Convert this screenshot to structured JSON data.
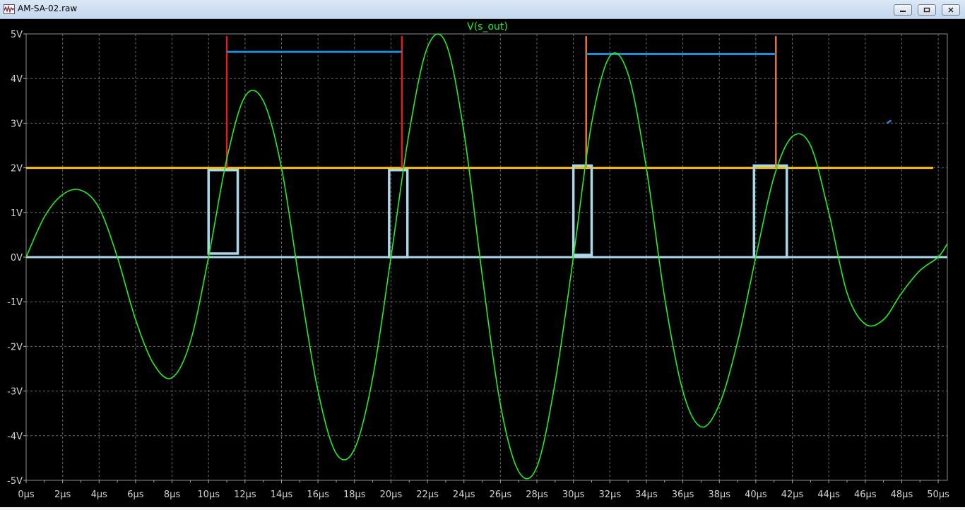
{
  "window": {
    "title": "AM-SA-02.raw"
  },
  "chart_data": {
    "type": "line",
    "title": "V(s_out)",
    "xlabel": "",
    "ylabel": "",
    "xlim": [
      0,
      50.5
    ],
    "ylim": [
      -5,
      5
    ],
    "x_ticks": [
      "0µs",
      "2µs",
      "4µs",
      "6µs",
      "8µs",
      "10µs",
      "12µs",
      "14µs",
      "16µs",
      "18µs",
      "20µs",
      "22µs",
      "24µs",
      "26µs",
      "28µs",
      "30µs",
      "32µs",
      "34µs",
      "36µs",
      "38µs",
      "40µs",
      "42µs",
      "44µs",
      "46µs",
      "48µs",
      "50µs"
    ],
    "y_ticks": [
      "5V",
      "4V",
      "3V",
      "2V",
      "1V",
      "0V",
      "-1V",
      "-2V",
      "-3V",
      "-4V",
      "-5V"
    ],
    "grid": true,
    "series": [
      {
        "name": "V(s_out)",
        "color": "#22ee22",
        "x_us": [
          0,
          1,
          2,
          3,
          4,
          5,
          6,
          7,
          8,
          9,
          10,
          11,
          12,
          13,
          14,
          15,
          16,
          17,
          18,
          19,
          20,
          21,
          22,
          23,
          24,
          25,
          26,
          27,
          28,
          29,
          30,
          31,
          32,
          33,
          34,
          35,
          36,
          37,
          38,
          39,
          40,
          41,
          42,
          43,
          44,
          45,
          46,
          47,
          48,
          49,
          50,
          50.5
        ],
        "y_v": [
          0,
          0.9,
          1.4,
          1.5,
          1.1,
          0,
          -1.4,
          -2.4,
          -2.7,
          -1.9,
          0,
          2.2,
          3.6,
          3.5,
          2.0,
          -0.6,
          -3.0,
          -4.4,
          -4.3,
          -2.7,
          0,
          2.8,
          4.7,
          4.8,
          2.8,
          -0.4,
          -3.3,
          -4.8,
          -4.7,
          -2.8,
          0,
          3.0,
          4.5,
          4.1,
          2.0,
          -0.9,
          -3.0,
          -3.8,
          -3.3,
          -1.9,
          0,
          1.8,
          2.7,
          2.5,
          1.0,
          -0.8,
          -1.5,
          -1.4,
          -0.8,
          -0.3,
          0,
          0.3
        ]
      }
    ],
    "annotations": {
      "threshold_line": {
        "y_v": 2,
        "x_from_us": 0,
        "x_to_us": 50.5,
        "color": "#ffc000"
      },
      "zero_line": {
        "y_v": 0,
        "x_from_us": 0,
        "x_to_us": 50.5,
        "color": "#a8d8ea"
      },
      "pulses": [
        {
          "x0_us": 10.0,
          "x1_us": 11.6,
          "y0_v": 0.08,
          "y1_v": 1.95
        },
        {
          "x0_us": 19.9,
          "x1_us": 20.9,
          "y0_v": 0.0,
          "y1_v": 1.95
        },
        {
          "x0_us": 30.0,
          "x1_us": 31.0,
          "y0_v": 0.05,
          "y1_v": 2.05
        },
        {
          "x0_us": 39.9,
          "x1_us": 41.7,
          "y0_v": 0.0,
          "y1_v": 2.05
        }
      ],
      "markers": [
        {
          "x_us": 11.0,
          "y_top_v": 4.95,
          "y_bottom_v": 2.0,
          "color": "#e02020"
        },
        {
          "x_us": 20.6,
          "y_top_v": 4.95,
          "y_bottom_v": 2.0,
          "color": "#e02020"
        },
        {
          "x_us": 30.7,
          "y_top_v": 4.95,
          "y_bottom_v": 2.0,
          "color": "#f07820"
        },
        {
          "x_us": 41.1,
          "y_top_v": 4.95,
          "y_bottom_v": 2.0,
          "color": "#f07820"
        }
      ],
      "spans": [
        {
          "x0_us": 11.0,
          "x1_us": 20.6,
          "y_v": 4.6,
          "color": "#1890e0"
        },
        {
          "x0_us": 30.7,
          "x1_us": 41.1,
          "y_v": 4.55,
          "color": "#1890e0"
        }
      ],
      "stray_mark": {
        "x_us": 47.3,
        "y_v": 3.03,
        "color": "#1890e0"
      }
    }
  }
}
